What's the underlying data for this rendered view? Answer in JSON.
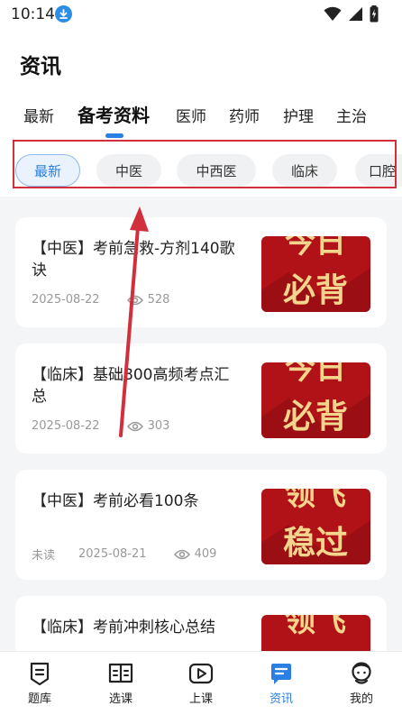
{
  "status_bar": {
    "time": "10:14"
  },
  "header": {
    "title": "资讯"
  },
  "tabs": [
    {
      "label": "最新"
    },
    {
      "label": "备考资料",
      "active": true
    },
    {
      "label": "医师"
    },
    {
      "label": "药师"
    },
    {
      "label": "护理"
    },
    {
      "label": "主治"
    }
  ],
  "filter_chips": [
    {
      "label": "最新",
      "active": true
    },
    {
      "label": "中医"
    },
    {
      "label": "中西医"
    },
    {
      "label": "临床"
    },
    {
      "label": "口腔"
    }
  ],
  "articles": [
    {
      "title": "【中医】考前急救-方剂140歌诀",
      "status": "",
      "date": "2025-08-22",
      "views": "528",
      "thumb_line1": "今日",
      "thumb_line2": "必背"
    },
    {
      "title": "【临床】基础800高频考点汇总",
      "status": "",
      "date": "2025-08-22",
      "views": "303",
      "thumb_line1": "今日",
      "thumb_line2": "必背"
    },
    {
      "title": "【中医】考前必看100条",
      "status": "未读",
      "date": "2025-08-21",
      "views": "409",
      "thumb_line1": "领飞",
      "thumb_line2": "稳过"
    },
    {
      "title": "【临床】考前冲刺核心总结",
      "status": "",
      "date": "",
      "views": "",
      "thumb_line1": "领飞",
      "thumb_line2": ""
    }
  ],
  "bottom_nav": [
    {
      "label": "题库",
      "icon": "question-bank-icon"
    },
    {
      "label": "选课",
      "icon": "course-select-icon"
    },
    {
      "label": "上课",
      "icon": "play-class-icon"
    },
    {
      "label": "资讯",
      "icon": "news-icon",
      "active": true
    },
    {
      "label": "我的",
      "icon": "profile-icon"
    }
  ],
  "colors": {
    "accent": "#2a7fe2",
    "annotation": "#d12f3c",
    "thumb_bg": "#b01217",
    "thumb_text": "#f4d58d"
  }
}
